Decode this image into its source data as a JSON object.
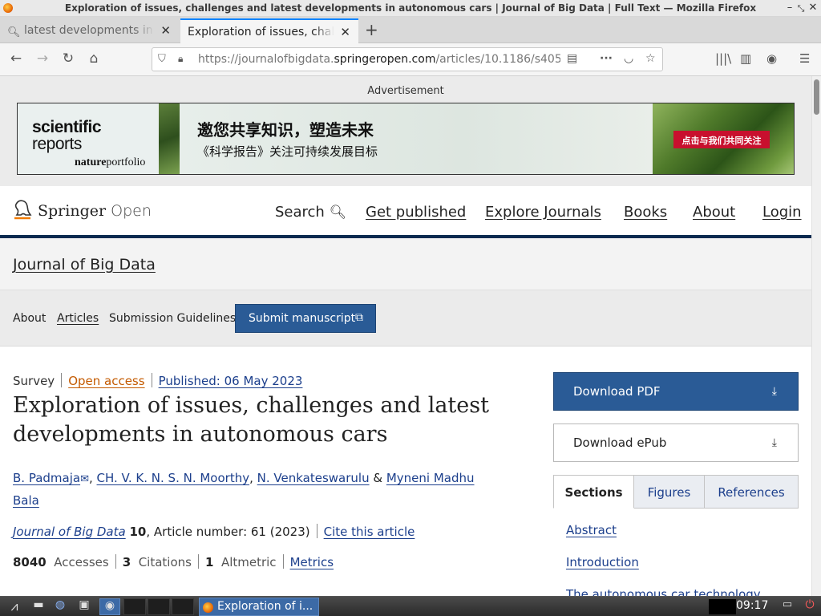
{
  "window": {
    "title": "Exploration of issues, challenges and latest developments in autonomous cars | Journal of Big Data | Full Text — Mozilla Firefox",
    "controls": [
      "minimize-icon",
      "restore-icon",
      "close-icon"
    ]
  },
  "tabs": [
    {
      "label": "latest developments in a",
      "icon": "search-icon",
      "active": false
    },
    {
      "label": "Exploration of issues, challe",
      "active": true
    }
  ],
  "nav": {
    "url_prefix": "https://journalofbigdata.",
    "url_domain": "springeropen.com",
    "url_suffix": "/articles/10.1186/s405"
  },
  "ad": {
    "label": "Advertisement",
    "brand_line1": "scientific",
    "brand_line2": "reports",
    "brand_pub_a": "nature",
    "brand_pub_b": "portfolio",
    "headline": "邀您共享知识，塑造未来",
    "subline": "《科学报告》关注可持续发展目标",
    "cta": "点击与我们共同关注"
  },
  "header": {
    "logo_name": "Springer",
    "logo_open": "Open",
    "nav": {
      "search": "Search",
      "get_published": "Get published",
      "explore": "Explore Journals",
      "books": "Books",
      "about": "About",
      "login": "Login"
    }
  },
  "journal": {
    "title": "Journal of Big Data",
    "links": {
      "about": "About",
      "articles": "Articles",
      "guidelines": "Submission Guidelines"
    },
    "submit": "Submit manuscript"
  },
  "article": {
    "type": "Survey",
    "access": "Open access",
    "published": "Published: 06 May 2023",
    "title": "Exploration of issues, challenges and latest developments in autonomous cars",
    "authors": {
      "a1": "B. Padmaja",
      "a2": "CH. V. K. N. S. N. Moorthy",
      "a3": "N. Venkateswarulu",
      "amp": "&",
      "a4_line1": "Myneni Madhu",
      "a4_line2": "Bala"
    },
    "citation": {
      "journal": "Journal of Big Data",
      "volume": "10",
      "rest": ", Article number: 61 (2023)",
      "cite": "Cite this article"
    },
    "metrics": {
      "accesses_n": "8040",
      "accesses": "Accesses",
      "citations_n": "3",
      "citations": "Citations",
      "altmetric_n": "1",
      "altmetric": "Altmetric",
      "link": "Metrics"
    }
  },
  "sidebar": {
    "download_pdf": "Download PDF",
    "download_epub": "Download ePub",
    "tabs": [
      "Sections",
      "Figures",
      "References"
    ],
    "sections": [
      "Abstract",
      "Introduction",
      "The autonomous car technology"
    ]
  },
  "taskbar": {
    "task_label": "Exploration of i...",
    "clock": "09:17"
  },
  "colors": {
    "springer_blue": "#2a5b96",
    "header_rule": "#0a2a4f",
    "link": "#1c3f8c",
    "open_access": "#c45a00",
    "firefox_accent": "#0a84ff"
  }
}
